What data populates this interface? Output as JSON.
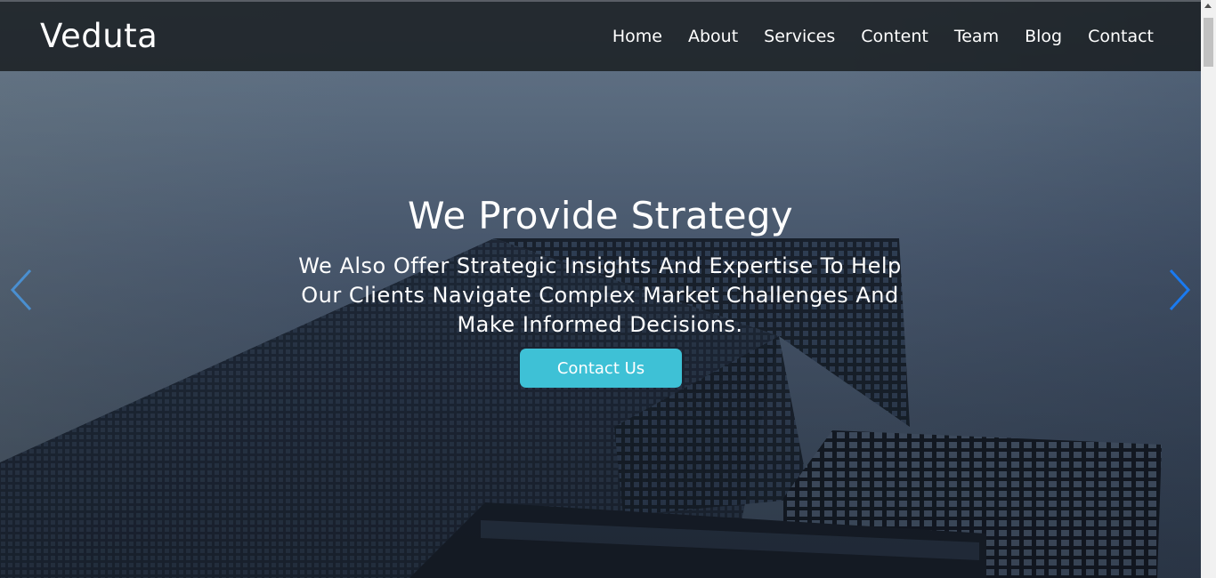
{
  "brand": {
    "name": "Veduta"
  },
  "nav": {
    "items": [
      "Home",
      "About",
      "Services",
      "Content",
      "Team",
      "Blog",
      "Contact"
    ]
  },
  "hero": {
    "headline": "We Provide Strategy",
    "subline": "We Also Offer Strategic Insights And Expertise To Help Our Clients Navigate Complex Market Challenges And Make Informed Decisions.",
    "cta_label": "Contact Us",
    "prev_icon": "chevron-left-icon",
    "next_icon": "chevron-right-icon"
  },
  "colors": {
    "accent": "#3ec1d6",
    "topbar": "#1a1e22",
    "arrow_left": "#4a8fd0",
    "arrow_right": "#1a7af0"
  }
}
